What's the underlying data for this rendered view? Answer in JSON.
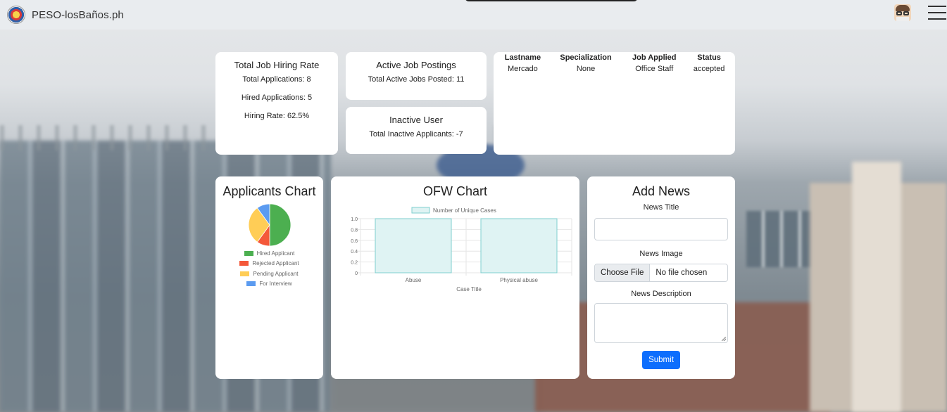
{
  "nav": {
    "brand": "PESO-losBaños.ph"
  },
  "hiring_card": {
    "title": "Total Job Hiring Rate",
    "total_applications": "Total Applications: 8",
    "hired_applications": "Hired Applications: 5",
    "hiring_rate": "Hiring Rate: 62.5%"
  },
  "active_card": {
    "title": "Active Job Postings",
    "text": "Total Active Jobs Posted: 11"
  },
  "inactive_card": {
    "title": "Inactive User",
    "text": "Total Inactive Applicants: -7"
  },
  "applications_table": {
    "headers": [
      "Lastname",
      "Specialization",
      "Job Applied",
      "Status"
    ],
    "rows": [
      [
        "Mercado",
        "None",
        "Office Staff",
        "accepted"
      ]
    ]
  },
  "applicants_chart": {
    "title": "Applicants Chart",
    "chart_data": {
      "type": "pie",
      "categories": [
        "Hired Applicant",
        "Rejected Applicant",
        "Pending Applicant",
        "For Interview"
      ],
      "values": [
        5,
        1,
        3,
        1
      ],
      "colors": [
        "#4caf50",
        "#f4583a",
        "#ffcd56",
        "#5b9bf0"
      ]
    }
  },
  "ofw_chart": {
    "title": "OFW Chart",
    "chart_data": {
      "type": "bar",
      "categories": [
        "Abuse",
        "Physical abuse"
      ],
      "series": [
        {
          "name": "Number of Unique Cases",
          "values": [
            1,
            1
          ]
        }
      ],
      "xlabel": "Case Title",
      "ylabel": "",
      "ylim": [
        0,
        1.0
      ],
      "yticks": [
        "0",
        "0.2",
        "0.4",
        "0.6",
        "0.8",
        "1.0"
      ],
      "bar_fill": "#dff3f3",
      "bar_stroke": "#7fcfcf"
    }
  },
  "news_form": {
    "title": "Add News",
    "news_title_label": "News Title",
    "news_image_label": "News Image",
    "choose_file_label": "Choose File",
    "file_status": "No file chosen",
    "news_description_label": "News Description",
    "submit_label": "Submit"
  }
}
